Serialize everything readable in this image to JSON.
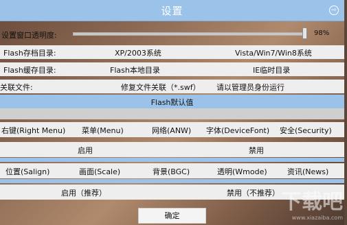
{
  "window": {
    "title": "设置",
    "close_glyph": "⇨"
  },
  "transparency": {
    "label": "设置窗口透明度:",
    "value_text": "98%",
    "level": 0.98
  },
  "flash_save_dir": {
    "label": "Flash存档目录:",
    "opt1": "XP/2003系统",
    "opt2": "Vista/Win7/Win8系统"
  },
  "flash_cache_dir": {
    "label": "Flash缓存目录:",
    "opt1": "Flash本地目录",
    "opt2": "IE临时目录"
  },
  "file_assoc": {
    "label": "关联文件:",
    "action": "修复文件关联（*.swf）",
    "note": "请以管理员身份运行"
  },
  "flash_defaults": {
    "header": "Flash默认值"
  },
  "menu_options": [
    "右键(Right Menu)",
    "菜单(Menu)",
    "网络(ANW)",
    "字体(DeviceFont)",
    "安全(Security)"
  ],
  "enable_row": {
    "enable": "启用",
    "disable": "禁用"
  },
  "display_options": [
    "位置(Salign)",
    "画面(Scale)",
    "背景(BGC)",
    "透明(Wmode)",
    "资讯(News)"
  ],
  "enable_row2": {
    "enable": "启用（推荐）",
    "disable": "禁用（不推荐）"
  },
  "ok_button": "确定",
  "watermark": {
    "main": "下载吧",
    "sub": "www.xiazaiba.com"
  }
}
